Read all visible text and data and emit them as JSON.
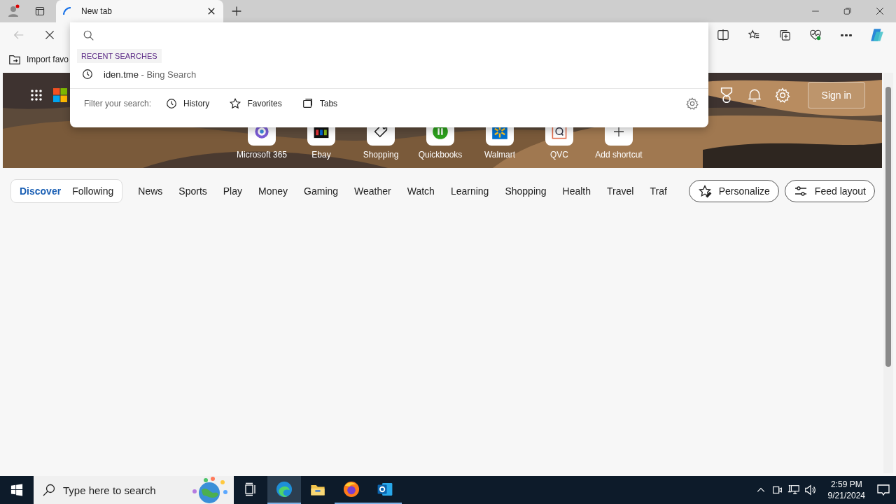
{
  "tabs": [
    {
      "title": "New tab",
      "selected": true,
      "loading": true
    }
  ],
  "favorites_bar": {
    "items": [
      "Import favo"
    ]
  },
  "address_dropdown": {
    "section_label": "RECENT SEARCHES",
    "suggestions": [
      {
        "query": "iden.tme",
        "source": "- Bing Search"
      }
    ],
    "filter_label": "Filter your search:",
    "filters": [
      {
        "label": "History",
        "kind": "history"
      },
      {
        "label": "Favorites",
        "kind": "favorites"
      },
      {
        "label": "Tabs",
        "kind": "tabs"
      }
    ]
  },
  "hero": {
    "sign_in": "Sign in",
    "shortcuts": [
      {
        "label": "Microsoft 365",
        "kind": "m365"
      },
      {
        "label": "Ebay",
        "kind": "ebay"
      },
      {
        "label": "Shopping",
        "kind": "tag"
      },
      {
        "label": "Quickbooks",
        "kind": "qb"
      },
      {
        "label": "Walmart",
        "kind": "walmart"
      },
      {
        "label": "QVC",
        "kind": "qvc"
      },
      {
        "label": "Add shortcut",
        "kind": "add"
      }
    ]
  },
  "feed": {
    "pivots": [
      {
        "label": "Discover",
        "selected": true
      },
      {
        "label": "Following",
        "selected": false
      }
    ],
    "categories": [
      "News",
      "Sports",
      "Play",
      "Money",
      "Gaming",
      "Weather",
      "Watch",
      "Learning",
      "Shopping",
      "Health",
      "Travel",
      "Traf"
    ],
    "buttons": [
      {
        "label": "Personalize",
        "kind": "personalize"
      },
      {
        "label": "Feed layout",
        "kind": "layout"
      }
    ]
  },
  "taskbar": {
    "search_placeholder": "Type here to search",
    "apps": [
      {
        "kind": "taskview",
        "active": false,
        "running": false
      },
      {
        "kind": "edge",
        "active": true,
        "running": true
      },
      {
        "kind": "files",
        "active": false,
        "running": false
      },
      {
        "kind": "firefox",
        "active": false,
        "running": true
      },
      {
        "kind": "outlook",
        "active": false,
        "running": true
      }
    ],
    "time": "2:59 PM",
    "date": "9/21/2024"
  }
}
